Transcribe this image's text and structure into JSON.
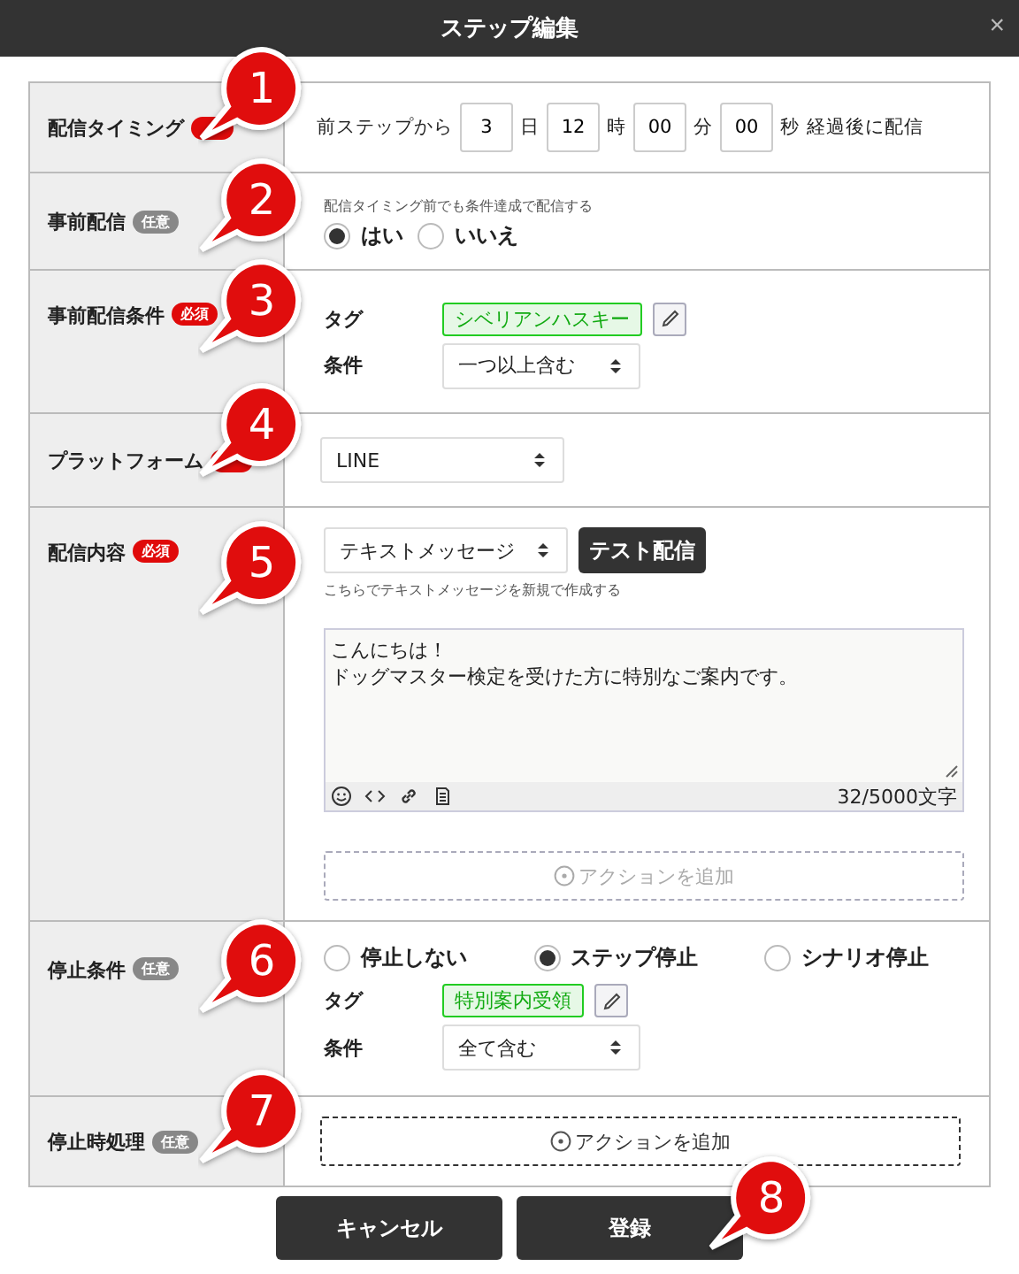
{
  "window": {
    "title": "ステップ編集",
    "close": "×"
  },
  "rows": [
    {
      "kind": "timing",
      "label": "配信タイミング",
      "badge": {
        "kind": "required"
      },
      "prefix": "前ステップから",
      "fields": [
        {
          "value": "3",
          "unit": "日"
        },
        {
          "value": "12",
          "unit": "時"
        },
        {
          "value": "00",
          "unit": "分"
        },
        {
          "value": "00",
          "unit": "秒"
        }
      ],
      "suffix": "経過後に配信"
    },
    {
      "kind": "radio",
      "label": "事前配信",
      "badge": {
        "kind": "optional",
        "label": "任意"
      },
      "hint": "配信タイミング前でも条件達成で配信する",
      "options": [
        {
          "label": "はい",
          "selected": true
        },
        {
          "label": "いいえ",
          "selected": false
        }
      ]
    },
    {
      "kind": "tags",
      "label": "事前配信条件",
      "badge": {
        "kind": "required",
        "label": "必須"
      },
      "tag_label": "タグ",
      "tags": [
        "シベリアンハスキー"
      ],
      "condition_label": "条件",
      "condition": "一つ以上含む"
    },
    {
      "kind": "select",
      "label": "プラットフォーム",
      "badge": {
        "kind": "required"
      },
      "value": "LINE"
    },
    {
      "kind": "content",
      "label": "配信内容",
      "badge": {
        "kind": "required",
        "label": "必須"
      },
      "type": "テキストメッセージ",
      "test_button": "テスト配信",
      "hint": "こちらでテキストメッセージを新規で作成する",
      "message_lines": [
        "こんにちは！",
        "ドッグマスター検定を受けた方に特別なご案内です。"
      ],
      "counter": "32/5000文字",
      "action": {
        "label": "アクションを追加",
        "disabled": true
      }
    },
    {
      "kind": "stop",
      "label": "停止条件",
      "badge": {
        "kind": "optional",
        "label": "任意"
      },
      "options": [
        {
          "label": "停止しない",
          "selected": false
        },
        {
          "label": "ステップ停止",
          "selected": true
        },
        {
          "label": "シナリオ停止",
          "selected": false
        }
      ],
      "tag_label": "タグ",
      "tags": [
        "特別案内受領"
      ],
      "condition_label": "条件",
      "condition": "全て含む"
    },
    {
      "kind": "action",
      "label": "停止時処理",
      "badge": {
        "kind": "optional",
        "label": "任意"
      },
      "action": {
        "label": "アクションを追加",
        "disabled": false
      }
    }
  ],
  "buttons": [
    "キャンセル",
    "登録"
  ],
  "callouts": [
    "1",
    "2",
    "3",
    "4",
    "5",
    "6",
    "7",
    "8"
  ]
}
